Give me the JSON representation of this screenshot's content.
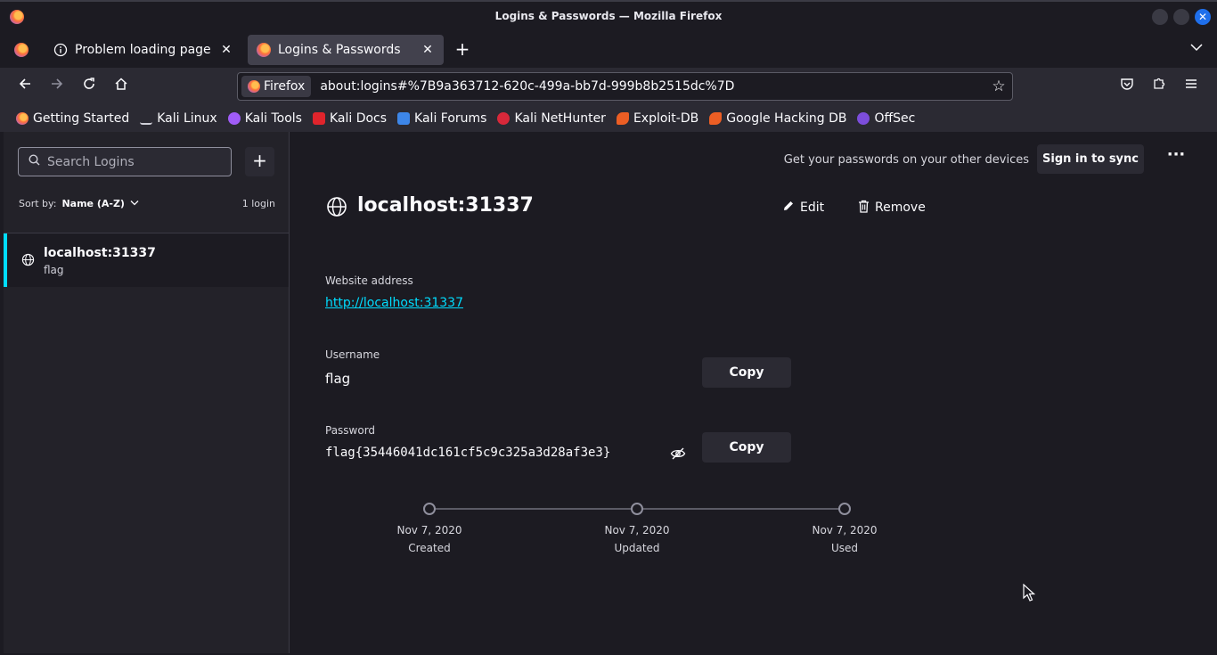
{
  "window": {
    "title": "Logins & Passwords — Mozilla Firefox"
  },
  "tabs": [
    {
      "label": "Problem loading page",
      "icon": "info-icon"
    },
    {
      "label": "Logins & Passwords",
      "icon": "firefox-icon",
      "active": true
    }
  ],
  "navbar": {
    "identity_label": "Firefox",
    "url": "about:logins#%7B9a363712-620c-499a-bb7d-999b8b2515dc%7D"
  },
  "bookmarks": [
    {
      "label": "Getting Started",
      "color": "#ff7139"
    },
    {
      "label": "Kali Linux",
      "color": "#367bf0"
    },
    {
      "label": "Kali Tools",
      "color": "#a05cf7"
    },
    {
      "label": "Kali Docs",
      "color": "#e0242c"
    },
    {
      "label": "Kali Forums",
      "color": "#3d86e8"
    },
    {
      "label": "Kali NetHunter",
      "color": "#d8283a"
    },
    {
      "label": "Exploit-DB",
      "color": "#ec5e24"
    },
    {
      "label": "Google Hacking DB",
      "color": "#ec5e24"
    },
    {
      "label": "OffSec",
      "color": "#7c4ddb"
    }
  ],
  "sidebar": {
    "search_placeholder": "Search Logins",
    "sort_label": "Sort by:",
    "sort_value": "Name (A-Z)",
    "count": "1 login",
    "items": [
      {
        "origin": "localhost:31337",
        "username": "flag"
      }
    ]
  },
  "main": {
    "sync_message": "Get your passwords on your other devices",
    "sync_button": "Sign in to sync",
    "more_label": "···",
    "title": "localhost:31337",
    "edit_label": "Edit",
    "remove_label": "Remove",
    "website_label": "Website address",
    "website_value": "http://localhost:31337",
    "username_label": "Username",
    "username_value": "flag",
    "password_label": "Password",
    "password_value": "flag{35446041dc161cf5c9c325a3d28af3e3}",
    "copy_label": "Copy",
    "timeline": [
      {
        "date": "Nov 7, 2020",
        "caption": "Created"
      },
      {
        "date": "Nov 7, 2020",
        "caption": "Updated"
      },
      {
        "date": "Nov 7, 2020",
        "caption": "Used"
      }
    ]
  },
  "colors": {
    "accent": "#00ddff",
    "background": "#1c1b22",
    "toolbar": "#2b2a33"
  }
}
